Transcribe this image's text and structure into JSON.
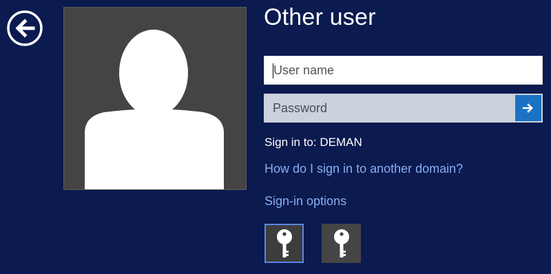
{
  "page": {
    "title": "Other user"
  },
  "form": {
    "username_placeholder": "User name",
    "password_placeholder": "Password",
    "sign_in_to": "Sign in to: DEMAN"
  },
  "links": {
    "other_domain": "How do I sign in to another domain?",
    "sign_in_options": "Sign-in options"
  },
  "icons": {
    "back": "back-arrow-icon",
    "avatar": "user-silhouette-icon",
    "submit": "arrow-right-icon",
    "option_1": "key-icon",
    "option_2": "key-icon"
  },
  "colors": {
    "background": "#0b1a4f",
    "avatar_tile": "#444444",
    "submit_button": "#1b72c4",
    "link": "#8aaef0",
    "selected_border": "#5b86e6"
  }
}
